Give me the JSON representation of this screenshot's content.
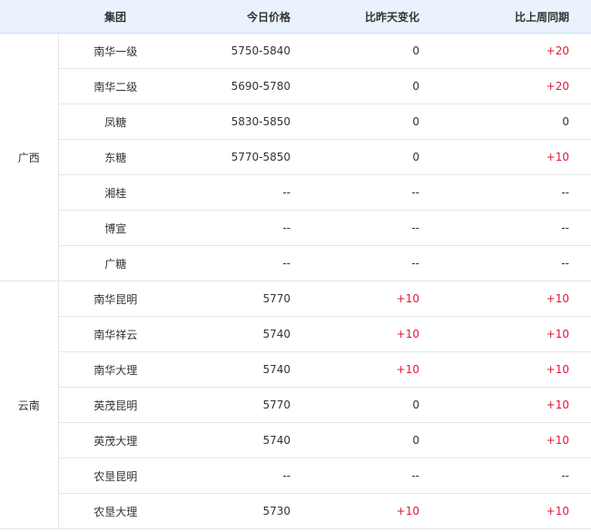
{
  "headers": {
    "region": "",
    "group": "集团",
    "price": "今日价格",
    "day_change": "比昨天变化",
    "week_change": "比上周同期"
  },
  "colors": {
    "header_bg": "#eaf3fd",
    "increase": "#e0163a",
    "text": "#333333"
  },
  "regions": [
    {
      "name": "广西",
      "rows": [
        {
          "group": "南华一级",
          "price": "5750-5840",
          "day_change": "0",
          "week_change": "+20"
        },
        {
          "group": "南华二级",
          "price": "5690-5780",
          "day_change": "0",
          "week_change": "+20"
        },
        {
          "group": "凤糖",
          "price": "5830-5850",
          "day_change": "0",
          "week_change": "0"
        },
        {
          "group": "东糖",
          "price": "5770-5850",
          "day_change": "0",
          "week_change": "+10"
        },
        {
          "group": "湘桂",
          "price": "--",
          "day_change": "--",
          "week_change": "--"
        },
        {
          "group": "博宣",
          "price": "--",
          "day_change": "--",
          "week_change": "--"
        },
        {
          "group": "广糖",
          "price": "--",
          "day_change": "--",
          "week_change": "--"
        }
      ]
    },
    {
      "name": "云南",
      "rows": [
        {
          "group": "南华昆明",
          "price": "5770",
          "day_change": "+10",
          "week_change": "+10"
        },
        {
          "group": "南华祥云",
          "price": "5740",
          "day_change": "+10",
          "week_change": "+10"
        },
        {
          "group": "南华大理",
          "price": "5740",
          "day_change": "+10",
          "week_change": "+10"
        },
        {
          "group": "英茂昆明",
          "price": "5770",
          "day_change": "0",
          "week_change": "+10"
        },
        {
          "group": "英茂大理",
          "price": "5740",
          "day_change": "0",
          "week_change": "+10"
        },
        {
          "group": "农垦昆明",
          "price": "--",
          "day_change": "--",
          "week_change": "--"
        },
        {
          "group": "农垦大理",
          "price": "5730",
          "day_change": "+10",
          "week_change": "+10"
        }
      ]
    }
  ]
}
